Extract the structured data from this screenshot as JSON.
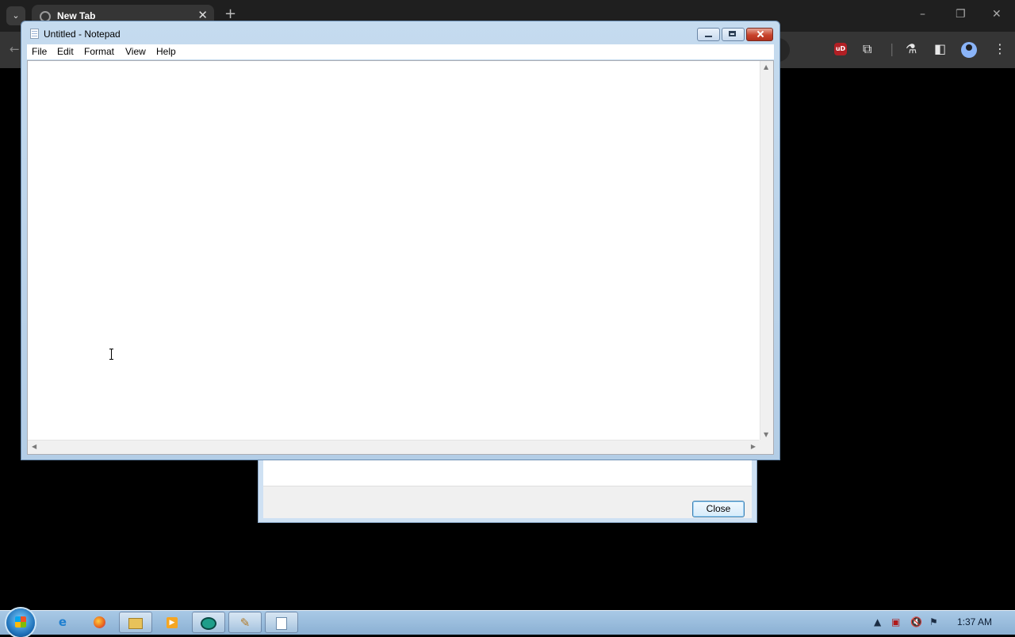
{
  "browser": {
    "tab_title": "New Tab",
    "tab_close": "✕",
    "new_tab": "+",
    "tab_menu": "⌄",
    "window_controls": [
      "–",
      "❐",
      "✕"
    ],
    "toolbar_icons": [
      "puzzle-icon",
      "flask-icon",
      "sidepanel-icon",
      "profile-icon",
      "menu-icon"
    ],
    "extension_badge": "uD"
  },
  "dialog": {
    "close_label": "Close"
  },
  "notepad": {
    "title": "Untitled - Notepad",
    "menu": [
      "File",
      "Edit",
      "Format",
      "View",
      "Help"
    ],
    "content": ""
  },
  "taskbar": {
    "pinned": [
      "internet-explorer-icon",
      "firefox-icon",
      "explorer-icon",
      "media-player-icon",
      "app-icon",
      "paint-icon",
      "notepad-icon"
    ],
    "clock": "1:37 AM"
  }
}
